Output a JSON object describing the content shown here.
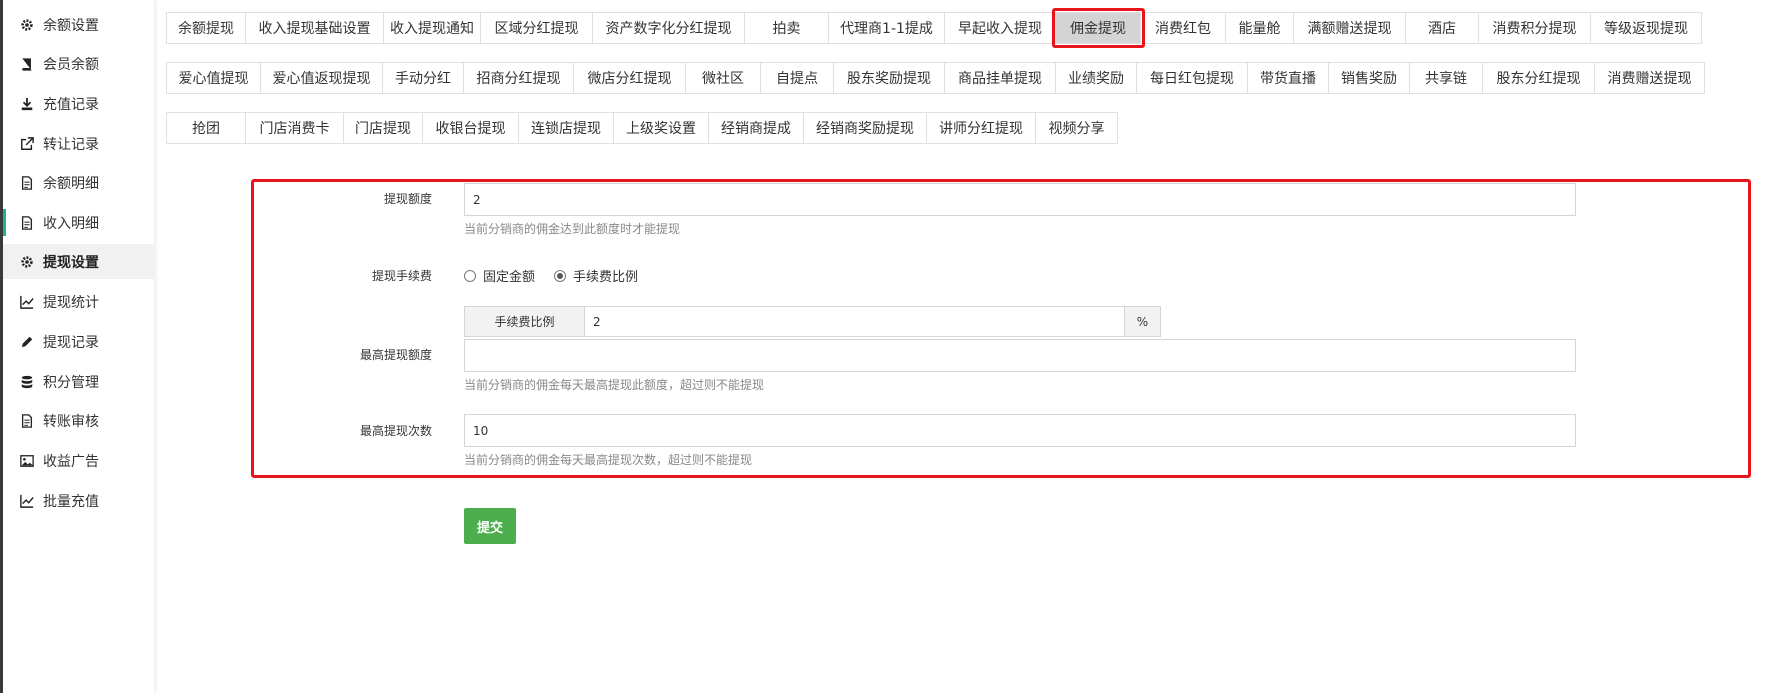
{
  "sidebar": {
    "items": [
      {
        "label": "余额设置",
        "icon": "gear-icon"
      },
      {
        "label": "会员余额",
        "icon": "book-icon"
      },
      {
        "label": "充值记录",
        "icon": "download-icon"
      },
      {
        "label": "转让记录",
        "icon": "external-link-icon"
      },
      {
        "label": "余额明细",
        "icon": "document-icon"
      },
      {
        "label": "收入明细",
        "icon": "document-icon"
      },
      {
        "label": "提现设置",
        "icon": "gear-icon"
      },
      {
        "label": "提现统计",
        "icon": "line-chart-icon"
      },
      {
        "label": "提现记录",
        "icon": "pencil-icon"
      },
      {
        "label": "积分管理",
        "icon": "database-icon"
      },
      {
        "label": "转账审核",
        "icon": "document-icon"
      },
      {
        "label": "收益广告",
        "icon": "image-icon"
      },
      {
        "label": "批量充值",
        "icon": "line-chart-icon"
      }
    ]
  },
  "tabs": {
    "row1": [
      "余额提现",
      "收入提现基础设置",
      "收入提现通知",
      "区域分红提现",
      "资产数字化分红提现",
      "拍卖",
      "代理商1-1提成",
      "早起收入提现",
      "佣金提现",
      "消费红包",
      "能量舱",
      "满额赠送提现",
      "酒店",
      "消费积分提现",
      "等级返现提现"
    ],
    "row2": [
      "爱心值提现",
      "爱心值返现提现",
      "手动分红",
      "招商分红提现",
      "微店分红提现",
      "微社区",
      "自提点",
      "股东奖励提现",
      "商品挂单提现",
      "业绩奖励",
      "每日红包提现",
      "带货直播",
      "销售奖励",
      "共享链",
      "股东分红提现",
      "消费赠送提现"
    ],
    "row3": [
      "抢团",
      "门店消费卡",
      "门店提现",
      "收银台提现",
      "连锁店提现",
      "上级奖设置",
      "经销商提成",
      "经销商奖励提现",
      "讲师分红提现",
      "视频分享"
    ]
  },
  "form": {
    "withdraw_amount": {
      "label": "提现额度",
      "value": "2",
      "help": "当前分销商的佣金达到此额度时才能提现"
    },
    "fee": {
      "label": "提现手续费",
      "option_fixed": "固定金额",
      "option_ratio": "手续费比例",
      "selected": "手续费比例",
      "ratio_addon": "手续费比例",
      "ratio_value": "2",
      "ratio_unit": "%"
    },
    "max_amount": {
      "label": "最高提现额度",
      "value": "",
      "help": "当前分销商的佣金每天最高提现此额度，超过则不能提现"
    },
    "max_count": {
      "label": "最高提现次数",
      "value": "10",
      "help": "当前分销商的佣金每天最高提现次数，超过则不能提现"
    },
    "submit_label": "提交"
  },
  "colors": {
    "highlight": "#e8141c",
    "accent": "#1ab394",
    "submit": "#4cae4c"
  }
}
